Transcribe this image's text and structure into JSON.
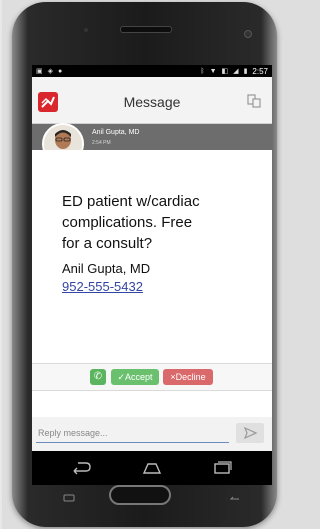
{
  "status_bar": {
    "left_icons": [
      "image-icon",
      "shield-icon",
      "record-icon"
    ],
    "right_icons": [
      "bluetooth-icon",
      "wifi-icon",
      "nfc-icon",
      "signal-icon",
      "battery-icon"
    ],
    "time": "2:57"
  },
  "app_bar": {
    "title": "Message",
    "logo_icon": "app-logo-icon",
    "action_icon": "contacts-icon"
  },
  "message": {
    "sender_name": "Anil Gupta, MD",
    "timestamp": "2:54 PM",
    "lines": [
      "ED patient w/cardiac",
      "complications. Free",
      "for a consult?"
    ],
    "signature": "Anil Gupta, MD",
    "phone": "952-555-5432"
  },
  "actions": {
    "call_icon": "phone-icon",
    "accept_label": "✓Accept",
    "decline_label": "×Decline"
  },
  "reply": {
    "placeholder": "Reply message...",
    "value": "",
    "send_icon": "send-icon"
  },
  "navigation": {
    "back_icon": "back-icon",
    "home_icon": "home-icon",
    "recents_icon": "recents-icon"
  },
  "colors": {
    "brand": "#d9272d",
    "accept": "#6bc06e",
    "decline": "#d9696b",
    "link": "#3345a3",
    "sender_bar": "#6d6d6d"
  }
}
